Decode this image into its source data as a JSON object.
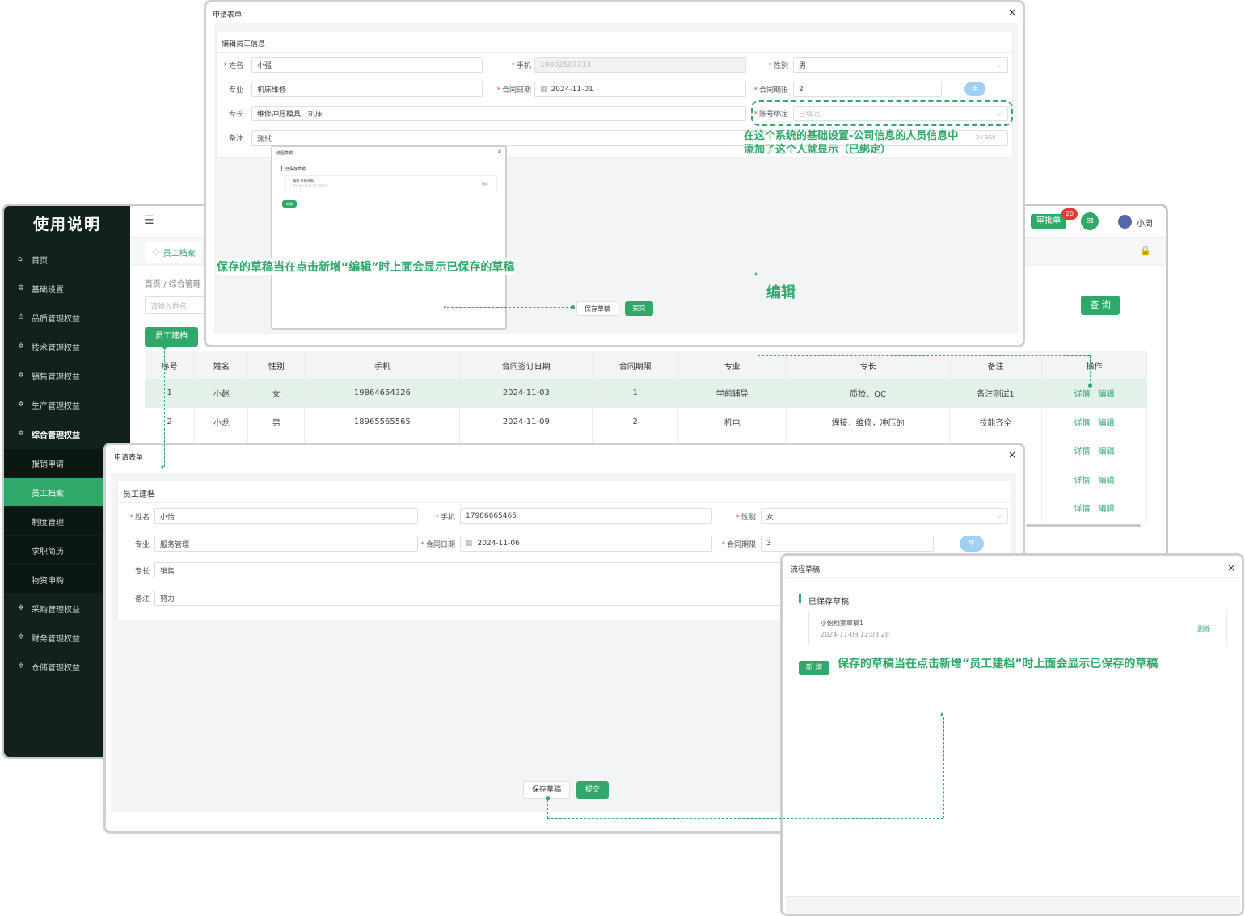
{
  "app": {
    "title": "使用说明",
    "user_name": "小周",
    "approval_label": "审批单",
    "approval_count": "20",
    "tab_label": "员工档案",
    "breadcrumb_home": "首页",
    "breadcrumb_sep": "/",
    "breadcrumb_section": "综合管理",
    "search_placeholder": "请输入姓名",
    "query_label": "查 询",
    "create_label": "员工建档"
  },
  "sidebar": {
    "items": [
      {
        "label": "首页",
        "icon": "⌂"
      },
      {
        "label": "基础设置",
        "icon": "⚙"
      },
      {
        "label": "品质管理权益",
        "icon": "♙"
      },
      {
        "label": "技术管理权益",
        "icon": "✲"
      },
      {
        "label": "销售管理权益",
        "icon": "✲"
      },
      {
        "label": "生产管理权益",
        "icon": "✲"
      },
      {
        "label": "综合管理权益",
        "icon": "✲"
      },
      {
        "label": "报销申请",
        "icon": ""
      },
      {
        "label": "员工档案",
        "icon": ""
      },
      {
        "label": "制度管理",
        "icon": ""
      },
      {
        "label": "求职简历",
        "icon": ""
      },
      {
        "label": "物资申购",
        "icon": ""
      },
      {
        "label": "采购管理权益",
        "icon": "✲"
      },
      {
        "label": "财务管理权益",
        "icon": "✲"
      },
      {
        "label": "仓储管理权益",
        "icon": "✲"
      }
    ]
  },
  "table": {
    "headers": [
      "序号",
      "姓名",
      "性别",
      "手机",
      "合同签订日期",
      "合同期限",
      "专业",
      "专长",
      "备注",
      "操作"
    ],
    "rows": [
      [
        "1",
        "小赵",
        "女",
        "19864654326",
        "2024-11-03",
        "1",
        "学前辅导",
        "质检、QC",
        "备注测试1"
      ],
      [
        "2",
        "小龙",
        "男",
        "18965565565",
        "2024-11-09",
        "2",
        "机电",
        "焊接，维修，冲压的",
        "技能齐全"
      ]
    ],
    "op_detail": "详情",
    "op_edit": "编辑"
  },
  "edit_form": {
    "window_title": "申请表单",
    "section_title": "编辑员工信息",
    "name_label": "姓名",
    "name_value": "小强",
    "phone_label": "手机",
    "phone_value": "19002507313",
    "gender_label": "性别",
    "gender_value": "男",
    "major_label": "专业",
    "major_value": "机床维修",
    "date_label": "合同日期",
    "date_value": "2024-11-01",
    "term_label": "合同期限",
    "term_value": "2",
    "term_unit": "年",
    "skill_label": "专长",
    "skill_value": "维修冲压模具、机床",
    "account_label": "账号绑定",
    "account_value": "已绑定",
    "remark_label": "备注",
    "remark_value": "测试",
    "remark_count": "2 / 256",
    "save_draft": "保存草稿",
    "submit": "提交"
  },
  "mini_draft": {
    "title": "流程草稿",
    "section": "已保存草稿",
    "item_name": "编辑-草稿草稿1",
    "item_time": "2024-11-08 11:50:51",
    "delete_label": "删除",
    "new_label": "新增"
  },
  "create_form": {
    "window_title": "申请表单",
    "section_title": "员工建档",
    "name_label": "姓名",
    "name_value": "小怡",
    "phone_label": "手机",
    "phone_value": "17986665465",
    "gender_label": "性别",
    "gender_value": "女",
    "major_label": "专业",
    "major_value": "服务管理",
    "date_label": "合同日期",
    "date_value": "2024-11-06",
    "term_label": "合同期限",
    "term_value": "3",
    "term_unit": "年",
    "skill_label": "专长",
    "skill_value": "销售",
    "remark_label": "备注",
    "remark_value": "努力",
    "save_draft": "保存草稿",
    "submit": "提交"
  },
  "draft_window": {
    "title": "流程草稿",
    "section": "已保存草稿",
    "item_name": "小怡档案草稿1",
    "item_time": "2024-11-08 12:03:28",
    "delete_label": "删除",
    "new_label": "新 增"
  },
  "annotations": {
    "account_note_line1": "在这个系统的基础设置-公司信息的人员信息中",
    "account_note_line2": "添加了这个人就显示（已绑定）",
    "edit_draft_note": "保存的草稿当在点击新增“编辑”时上面会显示已保存的草稿",
    "edit_label": "编辑",
    "create_draft_note": "保存的草稿当在点击新增“员工建档”时上面会显示已保存的草稿"
  },
  "colors": {
    "accent": "#2fa86a",
    "sidebar": "#102219",
    "badge": "#e53935",
    "unit_pill": "#9dd0f2"
  }
}
